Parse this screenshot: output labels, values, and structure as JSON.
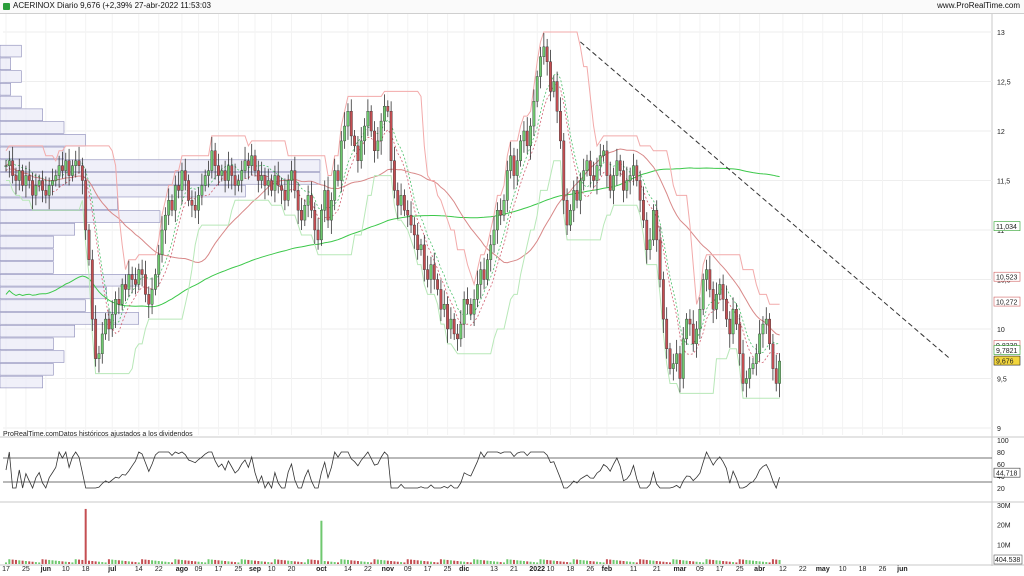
{
  "header": {
    "title": "ACERINOX Diario 9,676 (+2,39% 27-abr-2022 11:53:03",
    "site": "www.ProRealTime.com"
  },
  "footnote": "ProRealTime.comDatos históricos ajustados a los dividendos",
  "chart_data": [
    {
      "type": "line",
      "title": "ACERINOX Diario",
      "last_price": 9.676,
      "change_pct": 2.39,
      "date": "27-abr-2022 11:53:03",
      "ylim": [
        9,
        13
      ],
      "y_ticks": [
        "13",
        "12,5",
        "12",
        "11,5",
        "11",
        "10,5",
        "10",
        "9,5",
        "9"
      ],
      "x_ticks": [
        {
          "label": "17",
          "i": 0
        },
        {
          "label": "25",
          "i": 6
        },
        {
          "label": "jun",
          "i": 12,
          "bold": true
        },
        {
          "label": "10",
          "i": 18
        },
        {
          "label": "18",
          "i": 24
        },
        {
          "label": "jul",
          "i": 32,
          "bold": true
        },
        {
          "label": "14",
          "i": 40
        },
        {
          "label": "22",
          "i": 46
        },
        {
          "label": "ago",
          "i": 53,
          "bold": true
        },
        {
          "label": "09",
          "i": 58
        },
        {
          "label": "17",
          "i": 64
        },
        {
          "label": "25",
          "i": 70
        },
        {
          "label": "sep",
          "i": 75,
          "bold": true
        },
        {
          "label": "10",
          "i": 80
        },
        {
          "label": "20",
          "i": 86
        },
        {
          "label": "oct",
          "i": 95,
          "bold": true
        },
        {
          "label": "14",
          "i": 103
        },
        {
          "label": "22",
          "i": 109
        },
        {
          "label": "nov",
          "i": 115,
          "bold": true
        },
        {
          "label": "09",
          "i": 121
        },
        {
          "label": "17",
          "i": 127
        },
        {
          "label": "25",
          "i": 133
        },
        {
          "label": "dic",
          "i": 138,
          "bold": true
        },
        {
          "label": "13",
          "i": 147
        },
        {
          "label": "21",
          "i": 153
        },
        {
          "label": "2022",
          "i": 160,
          "bold": true
        },
        {
          "label": "10",
          "i": 164
        },
        {
          "label": "18",
          "i": 170
        },
        {
          "label": "26",
          "i": 176
        },
        {
          "label": "feb",
          "i": 181,
          "bold": true
        },
        {
          "label": "11",
          "i": 189
        },
        {
          "label": "21",
          "i": 196
        },
        {
          "label": "mar",
          "i": 203,
          "bold": true
        },
        {
          "label": "09",
          "i": 209
        },
        {
          "label": "17",
          "i": 215
        },
        {
          "label": "25",
          "i": 221
        },
        {
          "label": "abr",
          "i": 227,
          "bold": true
        },
        {
          "label": "12",
          "i": 234
        },
        {
          "label": "22",
          "i": 240
        },
        {
          "label": "may",
          "i": 246,
          "bold": true
        },
        {
          "label": "10",
          "i": 252
        },
        {
          "label": "18",
          "i": 258
        },
        {
          "label": "26",
          "i": 264
        },
        {
          "label": "jun",
          "i": 270,
          "bold": true
        }
      ],
      "price_labels": [
        {
          "text": "11,034",
          "value": 11.034,
          "color": "#2ca02c",
          "bg": "#ffffff"
        },
        {
          "text": "10,523",
          "value": 10.523,
          "color": "#d06060",
          "bg": "#ffffff"
        },
        {
          "text": "10,272",
          "value": 10.272,
          "color": "#d06060",
          "bg": "#ffffff"
        },
        {
          "text": "9,8330",
          "value": 9.833,
          "color": "#d06060",
          "bg": "#ffffff"
        },
        {
          "text": "9,7821",
          "value": 9.7821,
          "color": "#2ca02c",
          "bg": "#ffffff"
        },
        {
          "text": "9,676",
          "value": 9.676,
          "color": "#222222",
          "bg": "#f2d53c"
        }
      ],
      "close": [
        11.65,
        11.7,
        11.55,
        11.5,
        11.6,
        11.45,
        11.55,
        11.5,
        11.35,
        11.45,
        11.5,
        11.4,
        11.35,
        11.45,
        11.5,
        11.55,
        11.65,
        11.6,
        11.7,
        11.55,
        11.65,
        11.7,
        11.65,
        11.5,
        11.0,
        10.7,
        10.1,
        9.7,
        9.75,
        9.95,
        10.1,
        10.0,
        10.15,
        10.3,
        10.25,
        10.45,
        10.4,
        10.55,
        10.5,
        10.45,
        10.6,
        10.55,
        10.35,
        10.25,
        10.4,
        10.55,
        10.75,
        11.0,
        11.15,
        11.3,
        11.2,
        11.45,
        11.4,
        11.6,
        11.5,
        11.3,
        11.25,
        11.2,
        11.35,
        11.45,
        11.55,
        11.6,
        11.8,
        11.65,
        11.55,
        11.6,
        11.5,
        11.65,
        11.55,
        11.45,
        11.5,
        11.6,
        11.7,
        11.65,
        11.75,
        11.6,
        11.5,
        11.55,
        11.45,
        11.5,
        11.4,
        11.55,
        11.45,
        11.4,
        11.3,
        11.5,
        11.6,
        11.4,
        11.2,
        11.1,
        11.25,
        11.35,
        11.2,
        11.0,
        10.9,
        11.2,
        11.4,
        11.1,
        11.3,
        11.6,
        11.5,
        11.9,
        12.05,
        12.2,
        11.95,
        11.85,
        11.7,
        11.9,
        12.05,
        12.2,
        12.0,
        11.8,
        11.9,
        12.1,
        12.25,
        12.2,
        11.7,
        11.4,
        11.25,
        11.35,
        11.2,
        11.15,
        11.05,
        10.95,
        10.8,
        10.85,
        10.6,
        10.5,
        10.65,
        10.5,
        10.4,
        10.2,
        10.25,
        10.0,
        10.1,
        9.95,
        9.9,
        10.05,
        10.3,
        10.25,
        10.15,
        10.3,
        10.45,
        10.6,
        10.5,
        10.7,
        10.85,
        11.0,
        11.2,
        11.15,
        11.3,
        11.6,
        11.75,
        11.55,
        11.7,
        11.9,
        12.0,
        11.85,
        12.05,
        12.3,
        12.55,
        12.75,
        12.85,
        12.7,
        12.4,
        12.5,
        12.2,
        11.9,
        11.3,
        11.05,
        11.2,
        11.4,
        11.3,
        11.5,
        11.6,
        11.7,
        11.55,
        11.5,
        11.65,
        11.75,
        11.8,
        11.55,
        11.4,
        11.55,
        11.7,
        11.6,
        11.4,
        11.5,
        11.55,
        11.65,
        11.5,
        11.3,
        11.1,
        10.8,
        10.9,
        11.2,
        10.9,
        10.5,
        10.1,
        9.8,
        9.6,
        9.65,
        9.75,
        9.5,
        9.9,
        10.1,
        10.05,
        9.85,
        10.0,
        10.2,
        10.5,
        10.6,
        10.4,
        10.2,
        10.35,
        10.45,
        10.3,
        10.1,
        9.95,
        10.2,
        10.05,
        9.75,
        9.45,
        9.5,
        9.6,
        9.65,
        9.75,
        9.95,
        10.05,
        10.1,
        9.85,
        9.6,
        9.45,
        9.676
      ],
      "series": [
        {
          "name": "Media 200",
          "color": "#3cc84a",
          "values_from": "sma200"
        },
        {
          "name": "Media 50",
          "color": "#d88888",
          "values_from": "sma50"
        }
      ],
      "rsi": {
        "ylim": [
          0,
          100
        ],
        "ticks": [
          "100",
          "80",
          "60",
          "40",
          "20"
        ],
        "levels": [
          70,
          30
        ],
        "last": 44.718,
        "last_label": "44,718"
      },
      "volume": {
        "ticks": [
          "30M",
          "20M",
          "10M"
        ],
        "last_label": "404.538",
        "max": 30000000,
        "spikes": [
          {
            "i": 24,
            "value": 28000000
          },
          {
            "i": 95,
            "value": 22000000
          }
        ]
      }
    }
  ]
}
